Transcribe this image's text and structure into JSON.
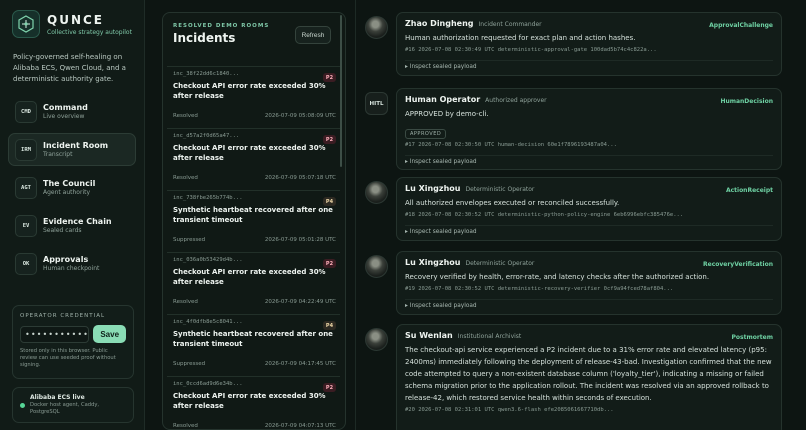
{
  "brand": {
    "name": "QUNCE",
    "tagline": "Collective strategy autopilot"
  },
  "blurb": "Policy-governed self-healing on Alibaba ECS, Qwen Cloud, and a deterministic authority gate.",
  "nav": [
    {
      "badge": "CMD",
      "title": "Command",
      "sub": "Live overview",
      "active": false
    },
    {
      "badge": "IRM",
      "title": "Incident Room",
      "sub": "Transcript",
      "active": true
    },
    {
      "badge": "AGT",
      "title": "The Council",
      "sub": "Agent authority",
      "active": false
    },
    {
      "badge": "EV",
      "title": "Evidence Chain",
      "sub": "Sealed cards",
      "active": false
    },
    {
      "badge": "OK",
      "title": "Approvals",
      "sub": "Human checkpoint",
      "active": false
    }
  ],
  "credential": {
    "label": "OPERATOR CREDENTIAL",
    "value": "••••••••••••••••••••••",
    "save_label": "Save",
    "note": "Stored only in this browser. Public review can use seeded proof without signing."
  },
  "live": {
    "title": "Alibaba ECS live",
    "sub": "Docker host agent, Caddy, PostgreSQL"
  },
  "incidents": {
    "eyebrow": "RESOLVED DEMO ROOMS",
    "title": "Incidents",
    "refresh_label": "Refresh",
    "items": [
      {
        "id": "inc_38f22dd6c1840...",
        "priority": "P2",
        "title": "Checkout API error rate exceeded 30% after release",
        "status": "Resolved",
        "time": "2026-07-09 05:08:09 UTC"
      },
      {
        "id": "inc_d57a2f0d65a47...",
        "priority": "P2",
        "title": "Checkout API error rate exceeded 30% after release",
        "status": "Resolved",
        "time": "2026-07-09 05:07:18 UTC"
      },
      {
        "id": "inc_738fbe265b774b...",
        "priority": "P4",
        "title": "Synthetic heartbeat recovered after one transient timeout",
        "status": "Suppressed",
        "time": "2026-07-09 05:01:28 UTC"
      },
      {
        "id": "inc_036a0b53429d4b...",
        "priority": "P2",
        "title": "Checkout API error rate exceeded 30% after release",
        "status": "Resolved",
        "time": "2026-07-09 04:22:49 UTC"
      },
      {
        "id": "inc_4f0dfb8e5c8041...",
        "priority": "P4",
        "title": "Synthetic heartbeat recovered after one transient timeout",
        "status": "Suppressed",
        "time": "2026-07-09 04:17:45 UTC"
      },
      {
        "id": "inc_0ccd6ad9d6e34b...",
        "priority": "P2",
        "title": "Checkout API error rate exceeded 30% after release",
        "status": "Resolved",
        "time": "2026-07-09 04:07:13 UTC"
      }
    ]
  },
  "timeline": [
    {
      "avatar": "photo",
      "name": "Zhao Dingheng",
      "role": "Incident Commander",
      "type": "ApprovalChallenge",
      "body": "Human authorization requested for exact plan and action hashes.",
      "badge": "",
      "meta": "#16  2026-07-08 02:30:49 UTC  deterministic-approval-gate  100dad5b74c4c822a...",
      "inspect": "▸ Inspect sealed payload"
    },
    {
      "avatar": "HITL",
      "name": "Human Operator",
      "role": "Authorized approver",
      "type": "HumanDecision",
      "body": "APPROVED by demo-cli.",
      "badge": "APPROVED",
      "meta": "#17  2026-07-08 02:30:50 UTC  human-decision  60e1f7896193487a04...",
      "inspect": "▸ Inspect sealed payload"
    },
    {
      "avatar": "photo",
      "name": "Lu Xingzhou",
      "role": "Deterministic Operator",
      "type": "ActionReceipt",
      "body": "All authorized envelopes executed or reconciled successfully.",
      "badge": "",
      "meta": "#18  2026-07-08 02:30:52 UTC  deterministic-python-policy-engine  6eb6996ebfc385476e...",
      "inspect": "▸ Inspect sealed payload"
    },
    {
      "avatar": "photo",
      "name": "Lu Xingzhou",
      "role": "Deterministic Operator",
      "type": "RecoveryVerification",
      "body": "Recovery verified by health, error-rate, and latency checks after the authorized action.",
      "badge": "",
      "meta": "#19  2026-07-08 02:30:52 UTC  deterministic-recovery-verifier  0cf9a94fced78af804...",
      "inspect": "▸ Inspect sealed payload"
    },
    {
      "avatar": "photo",
      "name": "Su Wenlan",
      "role": "Institutional Archivist",
      "type": "Postmortem",
      "body": "The checkout-api service experienced a P2 incident due to a 31% error rate and elevated latency (p95: 2400ms) immediately following the deployment of release-43-bad. Investigation confirmed that the new code attempted to query a non-existent database column ('loyalty_tier'), indicating a missing or failed schema migration prior to the application rollout. The incident was resolved via an approved rollback to release-42, which restored service health within seconds of execution.",
      "badge": "",
      "meta": "#20  2026-07-08 02:31:01 UTC  qwen3.6-flash  efe2085061667710db...",
      "inspect": ""
    }
  ]
}
